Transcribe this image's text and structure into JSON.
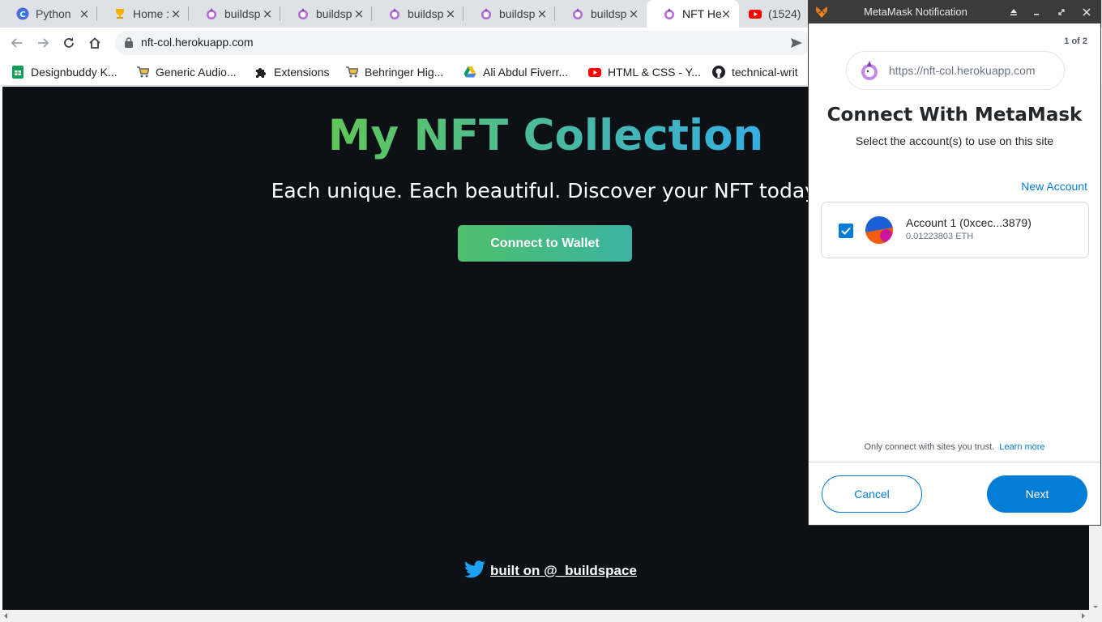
{
  "browser": {
    "tabs": [
      {
        "title": "Python",
        "icon": "python-c-icon",
        "active": false
      },
      {
        "title": "Home :",
        "icon": "trophy-icon",
        "active": false
      },
      {
        "title": "buildsp",
        "icon": "unicorn-icon",
        "active": false
      },
      {
        "title": "buildsp",
        "icon": "unicorn-icon",
        "active": false
      },
      {
        "title": "buildsp",
        "icon": "unicorn-icon",
        "active": false
      },
      {
        "title": "buildsp",
        "icon": "unicorn-icon",
        "active": false
      },
      {
        "title": "buildsp",
        "icon": "unicorn-icon",
        "active": false
      },
      {
        "title": "NFT He",
        "icon": "unicorn-icon",
        "active": true
      },
      {
        "title": "(1524)",
        "icon": "youtube-icon",
        "active": false
      }
    ],
    "tab_close_glyph": "×",
    "address": "nft-col.herokuapp.com",
    "bookmarks": [
      {
        "label": "Designbuddy K...",
        "icon": "google-sheets-icon"
      },
      {
        "label": "Generic Audio...",
        "icon": "shopping-cart-icon"
      },
      {
        "label": "Extensions",
        "icon": "puzzle-icon"
      },
      {
        "label": "Behringer Hig...",
        "icon": "shopping-cart-icon"
      },
      {
        "label": "Ali Abdul Fiverr...",
        "icon": "google-drive-icon"
      },
      {
        "label": "HTML & CSS - Y...",
        "icon": "youtube-icon"
      },
      {
        "label": "technical-writ",
        "icon": "github-icon"
      }
    ]
  },
  "page": {
    "title": "My NFT Collection",
    "subtitle": "Each unique. Each beautiful. Discover your NFT today.",
    "connect_button": "Connect to Wallet",
    "footer_text": "built on @_buildspace",
    "colors": {
      "background": "#0d1116",
      "gradient_start": "#60c657",
      "gradient_end": "#35aee2"
    }
  },
  "metamask": {
    "window_title": "MetaMask Notification",
    "page_indicator": "1 of 2",
    "site_url": "https://nft-col.herokuapp.com",
    "heading": "Connect With MetaMask",
    "subheading": "Select the account(s) to use on this site",
    "new_account": "New Account",
    "account": {
      "name": "Account 1 (0xcec...3879)",
      "balance": "0.01223803",
      "currency": "ETH",
      "checked": true
    },
    "trust_notice": "Only connect with sites you trust.",
    "learn_more": "Learn more",
    "cancel": "Cancel",
    "next": "Next",
    "colors": {
      "accent": "#037dd6"
    }
  }
}
